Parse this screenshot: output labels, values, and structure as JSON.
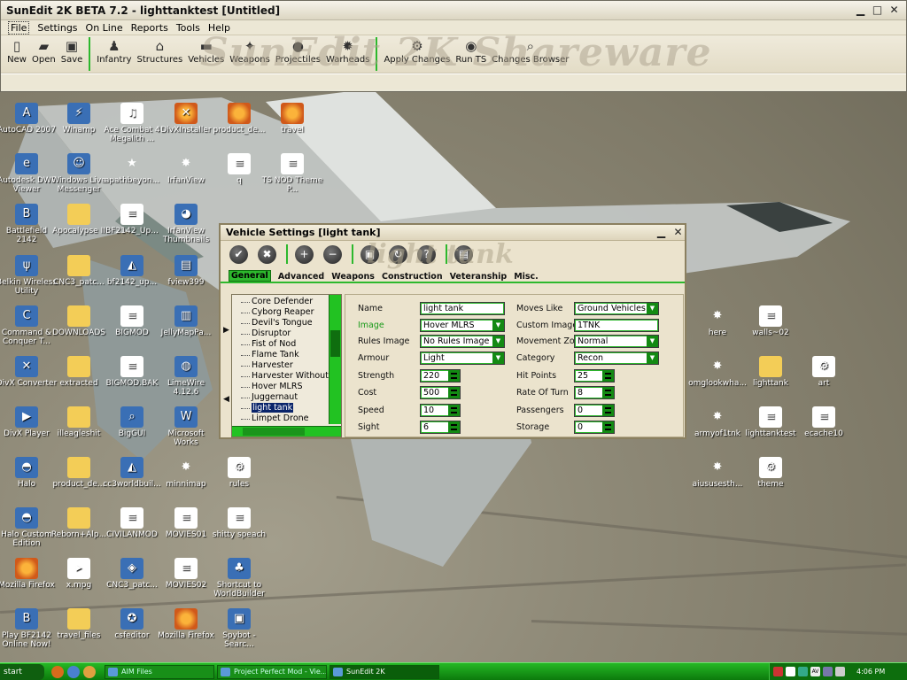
{
  "app": {
    "title": "SunEdit 2K BETA 7.2 - lighttanktest [Untitled]",
    "watermark": "SunEdit 2K Shareware",
    "menu": [
      "File",
      "Settings",
      "On Line",
      "Reports",
      "Tools",
      "Help"
    ],
    "toolbar": [
      {
        "label": "New",
        "icon": "new-file-icon",
        "glyph": "▯"
      },
      {
        "label": "Open",
        "icon": "open-folder-icon",
        "glyph": "▰"
      },
      {
        "label": "Save",
        "icon": "save-disk-icon",
        "glyph": "▣"
      },
      {
        "label": "Infantry",
        "icon": "infantry-icon",
        "glyph": "♟"
      },
      {
        "label": "Structures",
        "icon": "structures-icon",
        "glyph": "⌂"
      },
      {
        "label": "Vehicles",
        "icon": "vehicles-icon",
        "glyph": "▬"
      },
      {
        "label": "Weapons",
        "icon": "weapons-icon",
        "glyph": "✦"
      },
      {
        "label": "Projectiles",
        "icon": "projectiles-icon",
        "glyph": "●"
      },
      {
        "label": "Warheads",
        "icon": "warheads-icon",
        "glyph": "✹"
      },
      {
        "label": "Apply Changes",
        "icon": "apply-changes-icon",
        "glyph": "⚙"
      },
      {
        "label": "Run TS",
        "icon": "run-ts-icon",
        "glyph": "◉"
      },
      {
        "label": "Changes Browser",
        "icon": "changes-browser-icon",
        "glyph": "⌕"
      }
    ]
  },
  "desktop": [
    {
      "label": "AutoCAD 2007",
      "type": "app-i",
      "icon": "autocad-icon",
      "glyph": "A"
    },
    {
      "label": "Winamp",
      "type": "app-i",
      "icon": "winamp-icon",
      "glyph": "⚡"
    },
    {
      "label": "Ace Combat 4 Megalith ...",
      "type": "doc",
      "icon": "mp3-file-icon",
      "glyph": "♫"
    },
    {
      "label": "DivXInstaller",
      "type": "fire",
      "icon": "divx-installer-icon",
      "glyph": "✕"
    },
    {
      "label": "product_de...",
      "type": "fire",
      "icon": "firefox-doc-icon",
      "glyph": ""
    },
    {
      "label": "travel",
      "type": "fire",
      "icon": "firefox-doc-icon",
      "glyph": ""
    },
    {
      "label": "Autodesk DWF Viewer",
      "type": "app-i",
      "icon": "dwf-viewer-icon",
      "glyph": "e"
    },
    {
      "label": "Windows Live Messenger",
      "type": "app-i",
      "icon": "messenger-icon",
      "glyph": "☺"
    },
    {
      "label": "apathbeyon...",
      "type": "red",
      "icon": "red-star-icon",
      "glyph": "★"
    },
    {
      "label": "IrfanView",
      "type": "red",
      "icon": "irfanview-icon",
      "glyph": "✸"
    },
    {
      "label": "q",
      "type": "doc",
      "icon": "text-file-icon",
      "glyph": "≡"
    },
    {
      "label": "TS NOD Theme P...",
      "type": "doc",
      "icon": "text-file-icon",
      "glyph": "≡"
    },
    {
      "label": "Battlefield 2142",
      "type": "app-i",
      "icon": "bf2142-icon",
      "glyph": "B"
    },
    {
      "label": "Apocalypse II",
      "type": "fold",
      "icon": "folder-icon",
      "glyph": ""
    },
    {
      "label": "BF2142_Up...",
      "type": "doc",
      "icon": "doc-file-icon",
      "glyph": "≡"
    },
    {
      "label": "IrfanView Thumbnails",
      "type": "app-i",
      "icon": "panda-icon",
      "glyph": "◕"
    },
    {
      "label": "Belkin Wireless Utility",
      "type": "app-i",
      "icon": "belkin-icon",
      "glyph": "ψ"
    },
    {
      "label": "CNC3_patc...",
      "type": "fold",
      "icon": "folder-icon",
      "glyph": ""
    },
    {
      "label": "bf2142_up...",
      "type": "app-i",
      "icon": "installer-icon",
      "glyph": "◭"
    },
    {
      "label": "fview399",
      "type": "app-i",
      "icon": "fview-icon",
      "glyph": "▤"
    },
    {
      "label": "Command & Conquer T...",
      "type": "app-i",
      "icon": "cnc-icon",
      "glyph": "C"
    },
    {
      "label": "DOWNLOADS",
      "type": "fold",
      "icon": "folder-icon",
      "glyph": ""
    },
    {
      "label": "BIGMOD",
      "type": "doc",
      "icon": "doc-file-icon",
      "glyph": "≡"
    },
    {
      "label": "JellyMapPa...",
      "type": "app-i",
      "icon": "archive-icon",
      "glyph": "▥"
    },
    {
      "label": "DivX Converter",
      "type": "app-i",
      "icon": "divx-converter-icon",
      "glyph": "✕"
    },
    {
      "label": "extracted",
      "type": "fold",
      "icon": "folder-icon",
      "glyph": ""
    },
    {
      "label": "BIGMOD.BAK",
      "type": "doc",
      "icon": "doc-file-icon",
      "glyph": "≡"
    },
    {
      "label": "LimeWire 4.12.6",
      "type": "app-i",
      "icon": "limewire-icon",
      "glyph": "◍"
    },
    {
      "label": "DivX Player",
      "type": "app-i",
      "icon": "divx-player-icon",
      "glyph": "▶"
    },
    {
      "label": "illeagleshit",
      "type": "fold",
      "icon": "folder-icon",
      "glyph": ""
    },
    {
      "label": "BigGUI",
      "type": "app-i",
      "icon": "biggui-icon",
      "glyph": "⌕"
    },
    {
      "label": "Microsoft Works",
      "type": "app-i",
      "icon": "works-icon",
      "glyph": "W"
    },
    {
      "label": "Halo",
      "type": "app-i",
      "icon": "halo-icon",
      "glyph": "◓"
    },
    {
      "label": "product_de...",
      "type": "fold",
      "icon": "folder-icon",
      "glyph": ""
    },
    {
      "label": "cc3worldbuil...",
      "type": "app-i",
      "icon": "installer-icon",
      "glyph": "◭"
    },
    {
      "label": "minnimap",
      "type": "red",
      "icon": "irfanview-icon",
      "glyph": "✸"
    },
    {
      "label": "rules",
      "type": "doc",
      "icon": "ini-file-icon",
      "glyph": "⚙"
    },
    {
      "label": "Halo Custom Edition",
      "type": "app-i",
      "icon": "halo-icon",
      "glyph": "◓"
    },
    {
      "label": "Reborn+Alp...",
      "type": "fold",
      "icon": "folder-icon",
      "glyph": ""
    },
    {
      "label": "CIVILANMOD",
      "type": "doc",
      "icon": "doc-file-icon",
      "glyph": "≡"
    },
    {
      "label": "MOVIES01",
      "type": "doc",
      "icon": "doc-file-icon",
      "glyph": "≡"
    },
    {
      "label": "shitty speach",
      "type": "doc",
      "icon": "text-file-icon",
      "glyph": "≡"
    },
    {
      "label": "Mozilla Firefox",
      "type": "fire",
      "icon": "firefox-icon",
      "glyph": ""
    },
    {
      "label": "x.mpg",
      "type": "doc",
      "icon": "video-file-icon",
      "glyph": "▸"
    },
    {
      "label": "CNC3_patc...",
      "type": "app-i",
      "icon": "cnc3-patch-icon",
      "glyph": "◈"
    },
    {
      "label": "MOVIES02",
      "type": "doc",
      "icon": "doc-file-icon",
      "glyph": "≡"
    },
    {
      "label": "Shortcut to WorldBuilder",
      "type": "app-i",
      "icon": "worldbuilder-icon",
      "glyph": "♣"
    },
    {
      "label": "Play BF2142 Online Now!",
      "type": "app-i",
      "icon": "bf2142-icon",
      "glyph": "B"
    },
    {
      "label": "travel_files",
      "type": "fold",
      "icon": "folder-icon",
      "glyph": ""
    },
    {
      "label": "csfeditor",
      "type": "app-i",
      "icon": "csfeditor-icon",
      "glyph": "✪"
    },
    {
      "label": "Mozilla Firefox",
      "type": "fire",
      "icon": "firefox-icon",
      "glyph": ""
    },
    {
      "label": "Spybot - Searc...",
      "type": "app-i",
      "icon": "spybot-icon",
      "glyph": "▣"
    },
    {
      "label": "here",
      "type": "red",
      "icon": "irfanview-icon",
      "glyph": "✸"
    },
    {
      "label": "walls~02",
      "type": "doc",
      "icon": "doc-file-icon",
      "glyph": "≡"
    },
    {
      "label": "omglookwha...",
      "type": "red",
      "icon": "irfanview-icon",
      "glyph": "✸"
    },
    {
      "label": "lighttank",
      "type": "fold",
      "icon": "zip-folder-icon",
      "glyph": ""
    },
    {
      "label": "art",
      "type": "doc",
      "icon": "ini-file-icon",
      "glyph": "⚙"
    },
    {
      "label": "armyof1tnk",
      "type": "red",
      "icon": "irfanview-icon",
      "glyph": "✸"
    },
    {
      "label": "lighttanktest",
      "type": "doc",
      "icon": "doc-file-icon",
      "glyph": "≡"
    },
    {
      "label": "ecache10",
      "type": "doc",
      "icon": "text-file-icon",
      "glyph": "≡"
    },
    {
      "label": "aiususesth...",
      "type": "red",
      "icon": "irfanview-icon",
      "glyph": "✸"
    },
    {
      "label": "theme",
      "type": "doc",
      "icon": "ini-file-icon",
      "glyph": "⚙"
    }
  ],
  "dialog": {
    "title": "Vehicle Settings [light tank]",
    "watermark": "light tank",
    "tool_buttons": [
      {
        "icon": "ok-check-icon",
        "glyph": "✔"
      },
      {
        "icon": "cancel-x-icon",
        "glyph": "✖"
      },
      {
        "icon": "add-icon",
        "glyph": "+"
      },
      {
        "icon": "remove-icon",
        "glyph": "−"
      },
      {
        "icon": "copy-icon",
        "glyph": "▣"
      },
      {
        "icon": "refresh-icon",
        "glyph": "↻"
      },
      {
        "icon": "help-icon",
        "glyph": "?"
      },
      {
        "icon": "browse-icon",
        "glyph": "▤"
      }
    ],
    "tabs": [
      "General",
      "Advanced",
      "Weapons",
      "Construction",
      "Veteranship",
      "Misc."
    ],
    "list": [
      "Core Defender",
      "Cyborg Reaper",
      "Devil's Tongue",
      "Disruptor",
      "Fist of Nod",
      "Flame Tank",
      "Harvester",
      "Harvester Without B",
      "Hover MLRS",
      "Juggernaut",
      "light tank",
      "Limpet Drone"
    ],
    "selected": "light tank",
    "fields": {
      "name": {
        "label": "Name",
        "value": "light tank"
      },
      "image": {
        "label": "Image",
        "value": "Hover MLRS"
      },
      "rules_image": {
        "label": "Rules Image",
        "value": "No Rules Image Selec"
      },
      "armour": {
        "label": "Armour",
        "value": "Light"
      },
      "strength": {
        "label": "Strength",
        "value": "220"
      },
      "cost": {
        "label": "Cost",
        "value": "500"
      },
      "speed": {
        "label": "Speed",
        "value": "10"
      },
      "sight": {
        "label": "Sight",
        "value": "6"
      },
      "moves_like": {
        "label": "Moves Like",
        "value": "Ground Vehicles"
      },
      "custom_image": {
        "label": "Custom Image",
        "value": "1TNK"
      },
      "movement_zone": {
        "label": "Movement Zone",
        "value": "Normal"
      },
      "category": {
        "label": "Category",
        "value": "Recon"
      },
      "hit_points": {
        "label": "Hit Points",
        "value": "25"
      },
      "rate_of_turn": {
        "label": "Rate Of Turn",
        "value": "8"
      },
      "passengers": {
        "label": "Passengers",
        "value": "0"
      },
      "storage": {
        "label": "Storage",
        "value": "0"
      }
    }
  },
  "taskbar": {
    "start": "start",
    "tasks": [
      "AIM Files",
      "Project Perfect Mod - Vie...",
      "SunEdit 2K"
    ],
    "clock": "4:06 PM"
  },
  "colors": {
    "accent": "#2db82d",
    "taskbar": "#0c7a0c",
    "selection": "#0a246a"
  }
}
